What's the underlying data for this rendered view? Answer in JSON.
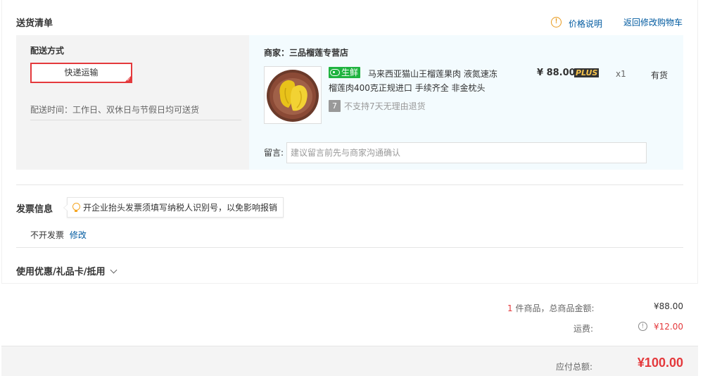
{
  "shipping_list": {
    "title": "送货清单",
    "price_info_label": "价格说明",
    "back_to_cart_label": "返回修改购物车",
    "delivery": {
      "method_title": "配送方式",
      "selected_method": "快递运输",
      "time_text": "配送时间：工作日、双休日与节假日均可送货"
    },
    "merchant": {
      "label": "商家：三品榴莲专营店"
    },
    "product": {
      "tag": "生鲜",
      "name_line1": "马来西亚猫山王榴莲果肉 液氮速冻",
      "name_line2": "榴莲肉400克正规进口 手续齐全 非金枕头",
      "no_return_badge": "7",
      "no_return_text": "不支持7天无理由退货",
      "price": "¥ 88.00",
      "plus_badge": "PLUS",
      "quantity": "x1",
      "stock": "有货"
    },
    "remark": {
      "label": "留言:",
      "placeholder": "建议留言前先与商家沟通确认"
    }
  },
  "invoice": {
    "title": "发票信息",
    "tip": "开企业抬头发票须填写纳税人识别号，以免影响报销",
    "value": "不开发票",
    "modify_label": "修改"
  },
  "coupon": {
    "title": "使用优惠/礼品卡/抵用"
  },
  "summary": {
    "item_count": "1",
    "item_label": "件商品，总商品金额:",
    "item_total": "¥88.00",
    "shipping_label": "运费:",
    "shipping_fee": "¥12.00",
    "payable_label": "应付总额:",
    "payable_total": "¥100.00"
  },
  "colors": {
    "accent_red": "#e4393c",
    "link_blue": "#005aa0",
    "fresh_green": "#1fb33f"
  },
  "icons": {
    "price_info": "info-circle-icon",
    "tip": "lightbulb-icon",
    "coupon_toggle": "chevron-down-icon",
    "fee_info": "info-circle-icon"
  }
}
